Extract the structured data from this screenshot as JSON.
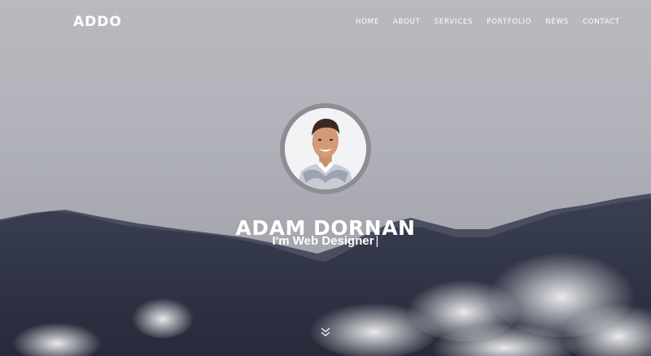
{
  "brand": {
    "logo_text": "ADDO"
  },
  "nav": {
    "items": [
      "HOME",
      "ABOUT",
      "SERVICES",
      "PORTFOLIO",
      "NEWS",
      "CONTACT"
    ]
  },
  "hero": {
    "name": "ADAM DORNAN",
    "tagline_prefix": "I'm",
    "tagline_role": "Web Designer",
    "cursor": "|",
    "scroll_icon": "chevron-double-down-icon"
  },
  "colors": {
    "sky": "#b5b6bd",
    "mountains": "#2f3445",
    "text": "#ffffff",
    "avatar_ring": "#8e8d95"
  }
}
